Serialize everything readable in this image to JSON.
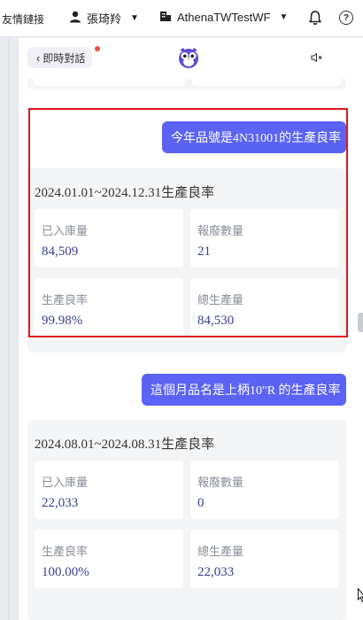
{
  "topbar": {
    "links_label": "友情鏈接",
    "user_name": "張琦羚",
    "org_name": "AthenaTWTestWF"
  },
  "chat_header": {
    "back_label": "即時對話"
  },
  "messages": [
    {
      "question": "今年品號是4N31001的生產良率",
      "range_title": "2024.01.01~2024.12.31生產良率",
      "cells": [
        {
          "label": "已入庫量",
          "value": "84,509"
        },
        {
          "label": "報廢數量",
          "value": "21"
        },
        {
          "label": "生產良率",
          "value": "99.98%"
        },
        {
          "label": "總生產量",
          "value": "84,530"
        }
      ]
    },
    {
      "question": "這個月品名是上柄10\"R 的生產良率",
      "range_title": "2024.08.01~2024.08.31生產良率",
      "cells": [
        {
          "label": "已入庫量",
          "value": "22,033"
        },
        {
          "label": "報廢數量",
          "value": "0"
        },
        {
          "label": "生產良率",
          "value": "100.00%"
        },
        {
          "label": "總生產量",
          "value": "22,033"
        }
      ]
    }
  ],
  "colors": {
    "accent": "#5b63f5",
    "highlight_box": "#e1161c",
    "value_text": "#3a3f8f"
  }
}
